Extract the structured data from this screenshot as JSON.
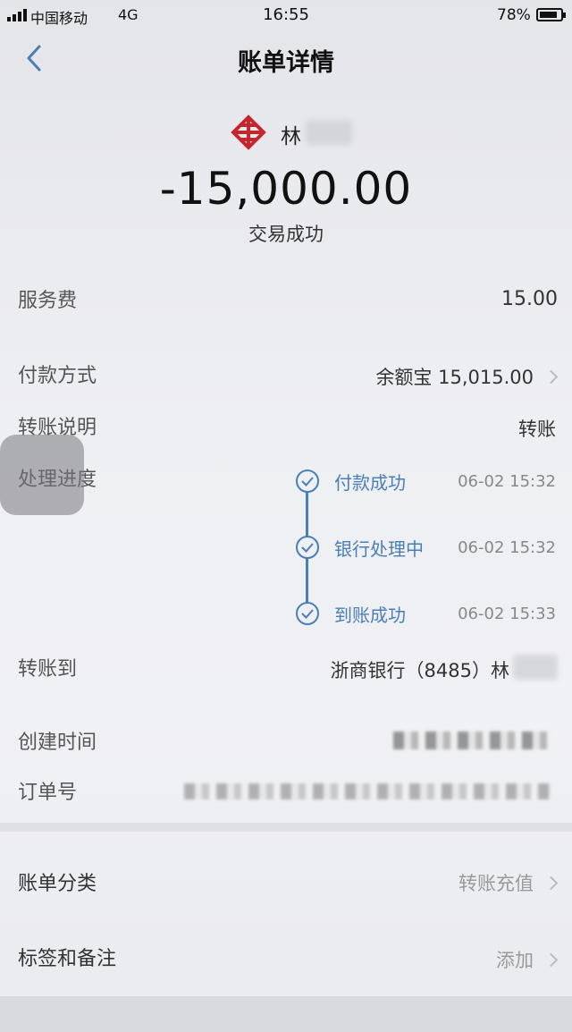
{
  "status_bar": {
    "carrier": "中国移动",
    "network": "4G",
    "time": "16:55",
    "battery": "78%"
  },
  "nav": {
    "title": "账单详情"
  },
  "header": {
    "payee_name": "林",
    "amount": "-15,000.00",
    "status": "交易成功",
    "logo_color": "#c4262e"
  },
  "rows": {
    "service_fee": {
      "label": "服务费",
      "value": "15.00"
    },
    "payment_method": {
      "label": "付款方式",
      "value": "余额宝 15,015.00"
    },
    "transfer_note": {
      "label": "转账说明",
      "value": "转账"
    },
    "progress": {
      "label": "处理进度"
    },
    "transfer_to": {
      "label": "转账到",
      "value": "浙商银行（8485）林"
    },
    "created_time": {
      "label": "创建时间"
    },
    "order_no": {
      "label": "订单号"
    },
    "category": {
      "label": "账单分类",
      "value": "转账充值"
    },
    "tags": {
      "label": "标签和备注",
      "value": "添加"
    }
  },
  "progress_steps": [
    {
      "label": "付款成功",
      "time": "06-02 15:32"
    },
    {
      "label": "银行处理中",
      "time": "06-02 15:32"
    },
    {
      "label": "到账成功",
      "time": "06-02 15:33"
    }
  ],
  "colors": {
    "accent": "#4a7fb6"
  }
}
